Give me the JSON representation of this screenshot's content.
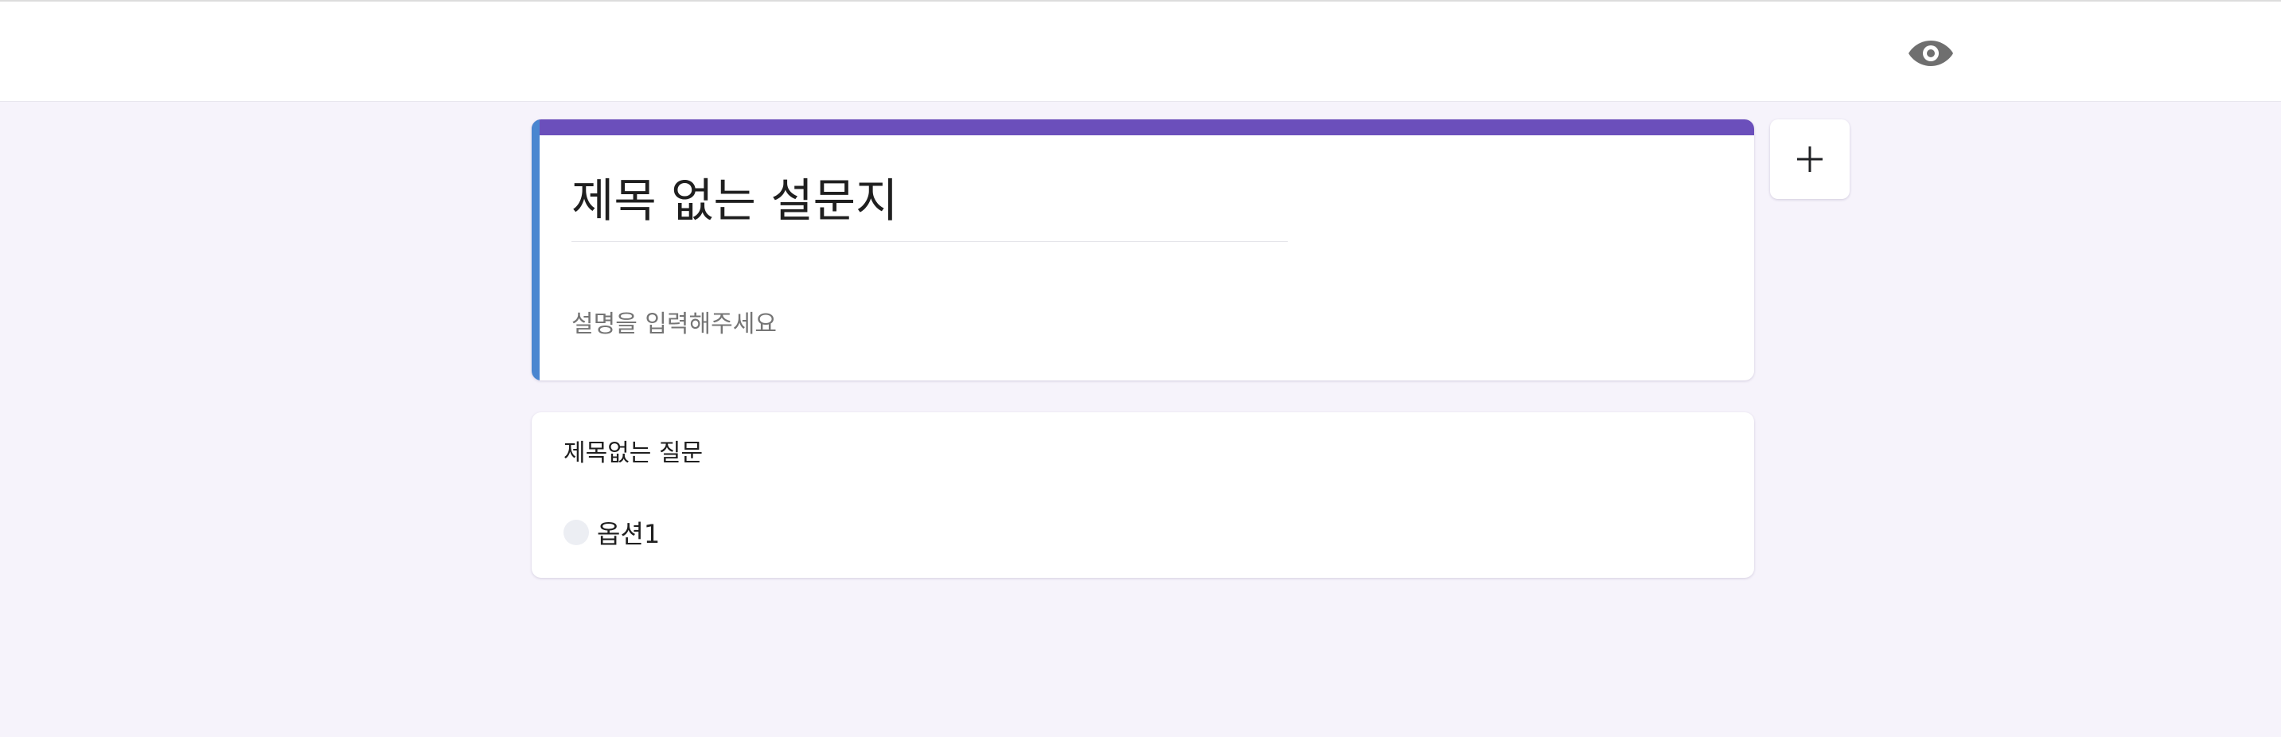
{
  "header": {
    "preview_icon": "eye-icon"
  },
  "form": {
    "title": "제목 없는 설문지",
    "description_placeholder": "설명을 입력해주세요",
    "accent_color": "#6b4fbb",
    "focus_color": "#4a86d0"
  },
  "toolbar": {
    "add_icon": "plus-icon"
  },
  "questions": [
    {
      "title": "제목없는 질문",
      "options": [
        {
          "label": "옵션1"
        }
      ]
    }
  ]
}
